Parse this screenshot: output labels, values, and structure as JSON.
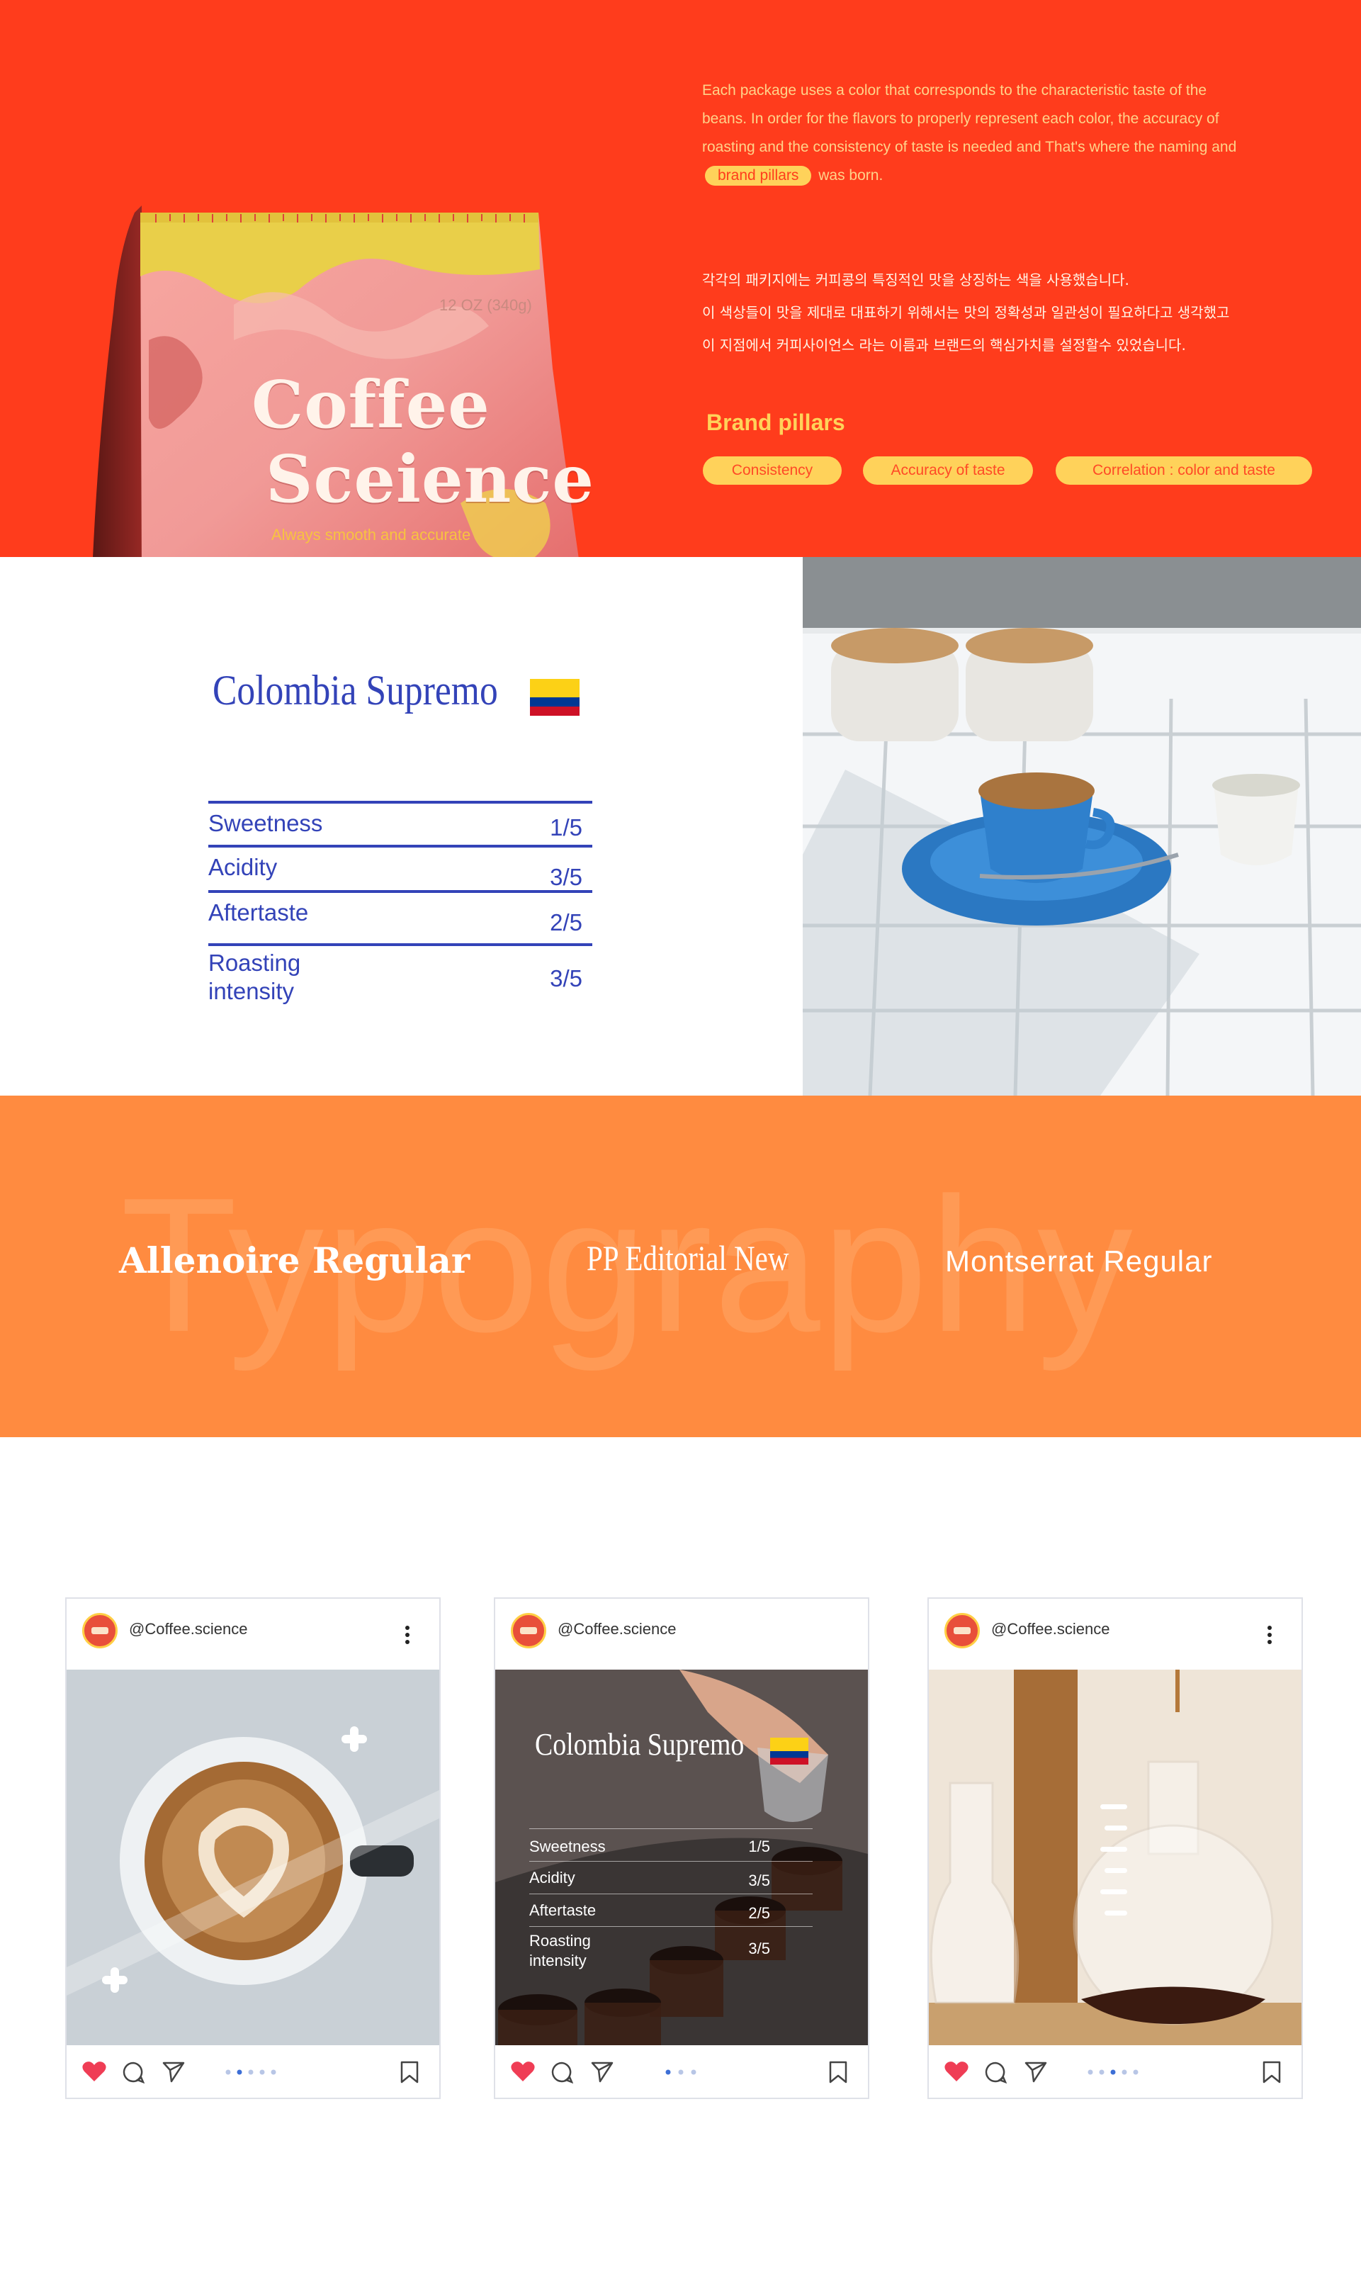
{
  "colors": {
    "red": "#ff3c1c",
    "yellow": "#ffd25a",
    "blue": "#3343b8",
    "orange": "#ff8b40"
  },
  "hero": {
    "bag": {
      "brand_line1": "Coffee",
      "brand_line2": "Sceience",
      "weight": "12 OZ (340g)",
      "tagline": "Always smooth and accurate"
    },
    "description_en": {
      "before_pill": "Each package uses a color that corresponds to the characteristic taste of the beans. In order for the flavors to properly represent each color, the accuracy of roasting and the consistency of taste is needed and That's where the naming and",
      "pill": "brand pillars",
      "after_pill": "was born."
    },
    "description_kr": [
      "각각의 패키지에는 커피콩의 특징적인 맛을 상징하는 색을 사용했습니다.",
      "이 색상들이 맛을 제대로 대표하기 위해서는 맛의 정확성과 일관성이 필요하다고 생각했고",
      "이 지점에서 커피사이언스 라는 이름과 브랜드의  핵심가치를 설정할수 있었습니다."
    ],
    "pillars_title": "Brand pillars",
    "pillars": [
      "Consistency",
      "Accuracy of taste",
      "Correlation : color and taste"
    ]
  },
  "tasting": {
    "origin": "Colombia Supremo",
    "rows": [
      {
        "label": "Sweetness",
        "value": "1/5"
      },
      {
        "label": "Acidity",
        "value": "3/5"
      },
      {
        "label": "Aftertaste",
        "value": "2/5"
      },
      {
        "label": "Roasting\nintensity",
        "value": "3/5"
      }
    ]
  },
  "typography": {
    "background_word": "Typography",
    "fonts": [
      "Allenoire Regular",
      "PP Editorial New",
      "Montserrat Regular"
    ]
  },
  "posts": [
    {
      "handle": "@Coffee.science",
      "image": "latte-art-photo",
      "pager_count": 5,
      "pager_active": 1
    },
    {
      "handle": "@Coffee.science",
      "image": "pour-over-photo",
      "pager_count": 3,
      "pager_active": 0,
      "overlay": {
        "origin": "Colombia Supremo",
        "rows": [
          {
            "label": "Sweetness",
            "value": "1/5"
          },
          {
            "label": "Acidity",
            "value": "3/5"
          },
          {
            "label": "Aftertaste",
            "value": "2/5"
          },
          {
            "label": "Roasting\nintensity",
            "value": "3/5"
          }
        ]
      }
    },
    {
      "handle": "@Coffee.science",
      "image": "glass-flask-photo",
      "pager_count": 5,
      "pager_active": 2
    }
  ]
}
